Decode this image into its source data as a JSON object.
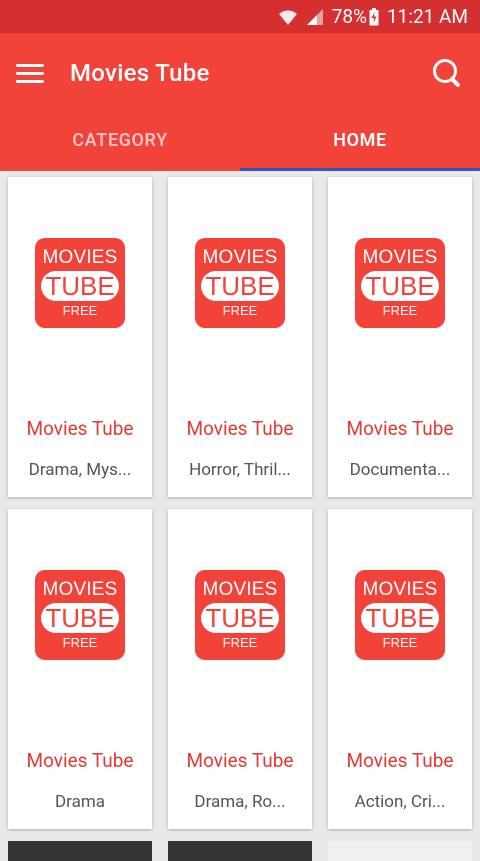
{
  "status": {
    "battery": "78%",
    "time": "11:21 AM"
  },
  "appbar": {
    "title": "Movies Tube"
  },
  "tabs": [
    {
      "label": "CATEGORY"
    },
    {
      "label": "HOME"
    }
  ],
  "logo": {
    "top": "MOVIES",
    "middle": "TUBE",
    "bottom": "FREE"
  },
  "cards": [
    {
      "title": "Movies Tube",
      "genre": "Drama, Mys..."
    },
    {
      "title": "Movies Tube",
      "genre": "Horror, Thril..."
    },
    {
      "title": "Movies Tube",
      "genre": "Documenta..."
    },
    {
      "title": "Movies Tube",
      "genre": "Drama"
    },
    {
      "title": "Movies Tube",
      "genre": "Drama, Ro..."
    },
    {
      "title": "Movies Tube",
      "genre": "Action, Cri..."
    }
  ],
  "colors": {
    "primary": "#f2433b",
    "status_bar": "#d3302f",
    "tab_indicator": "#3f51b5"
  }
}
